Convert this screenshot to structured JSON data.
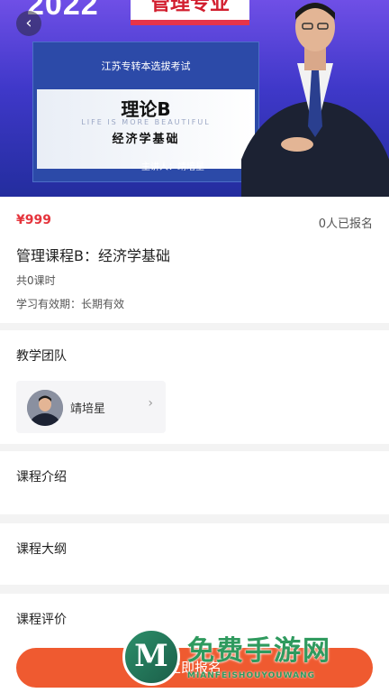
{
  "banner": {
    "year": "2022",
    "major": "管理专业",
    "exam_title": "江苏专转本选拔考试",
    "course_code": "理论B",
    "motto": "LIFE IS MORE BEAUTIFUL",
    "subject": "经济学基础",
    "lecturer": "主讲人：靖培星"
  },
  "course": {
    "price": "¥999",
    "enrolled": "0人已报名",
    "title": "管理课程B：经济学基础",
    "hours": "共0课时",
    "validity": "学习有效期：长期有效"
  },
  "sections": {
    "team_title": "教学团队",
    "teacher_name": "靖培星",
    "intro_title": "课程介绍",
    "outline_title": "课程大纲",
    "review_title": "课程评价"
  },
  "cta": {
    "label": "立即报名"
  },
  "watermark": {
    "text": "免费手游网",
    "sub": "MIANFEISHOUYOUWANG",
    "logo": "M"
  },
  "colors": {
    "accent": "#ef5a30",
    "price": "#e5343c",
    "banner": "#3f38c9"
  }
}
